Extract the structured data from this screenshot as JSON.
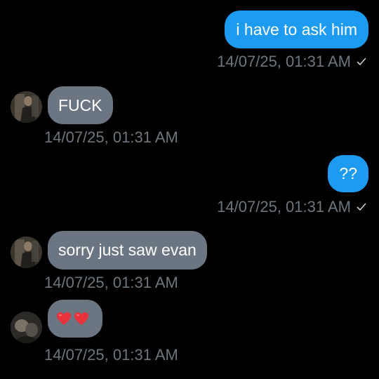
{
  "messages": [
    {
      "direction": "outgoing",
      "text": "i have to ask him",
      "timestamp": "14/07/25, 01:31 AM",
      "read_icon": "check-icon"
    },
    {
      "direction": "incoming",
      "text": "FUCK",
      "timestamp": "14/07/25, 01:31 AM",
      "avatar_icon": "avatar"
    },
    {
      "direction": "outgoing",
      "text": "??",
      "timestamp": "14/07/25, 01:31 AM",
      "read_icon": "check-icon"
    },
    {
      "direction": "incoming",
      "text": "sorry just saw evan",
      "timestamp": "14/07/25, 01:31 AM",
      "avatar_icon": "avatar"
    },
    {
      "direction": "incoming",
      "text": "❤️❤️",
      "timestamp": "14/07/25, 01:31 AM",
      "avatar_icon": "avatar",
      "content_icons": [
        "heart-icon",
        "heart-icon"
      ]
    }
  ],
  "colors": {
    "background": "#000000",
    "outgoing_bubble": "#1d9bf0",
    "incoming_bubble": "#6c7682",
    "timestamp": "#6e767d",
    "heart": "#e8323c"
  }
}
